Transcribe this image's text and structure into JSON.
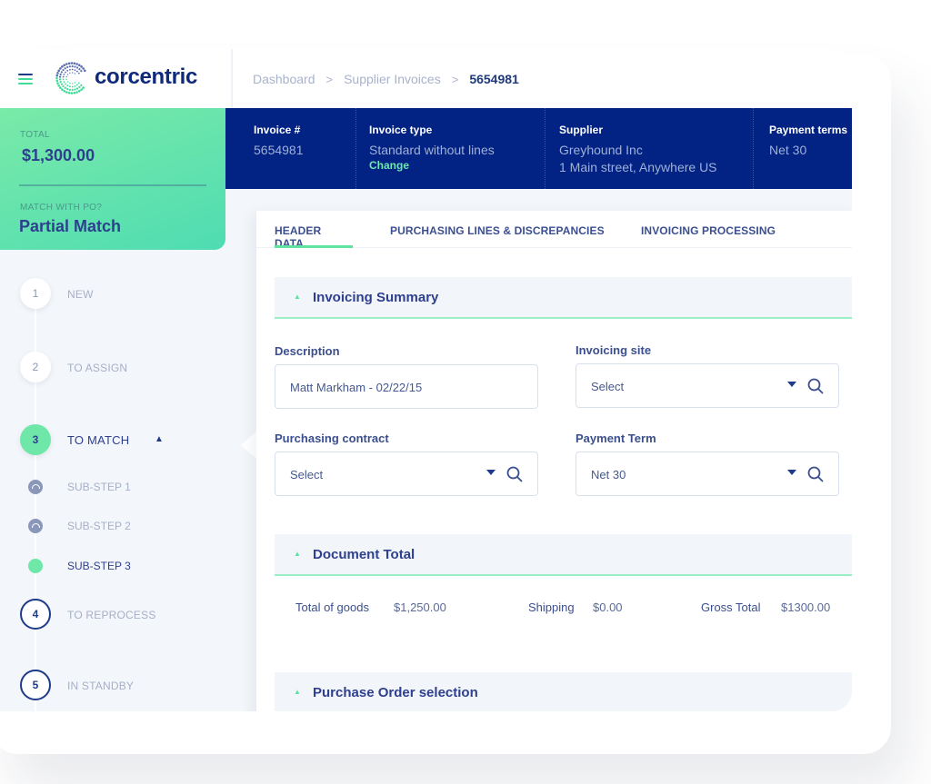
{
  "app": {
    "brand": "corcentric",
    "colors": {
      "navy": "#022383",
      "accent_green": "#5ee3a0",
      "text_dark": "#2e3f8f",
      "text_muted": "#a5b0c8",
      "background": "#f3f6fa"
    }
  },
  "topbar": {
    "menu_icon": "hamburger-menu-icon",
    "logo_icon": "corcentric-dotted-circle-logo",
    "breadcrumb": {
      "items": [
        "Dashboard",
        "Supplier Invoices"
      ],
      "separator": ">",
      "current": "5654981"
    }
  },
  "summary": {
    "total_label": "TOTAL",
    "total_value": "$1,300.00",
    "match_label": "MATCH WITH PO?",
    "match_value": "Partial Match"
  },
  "invoice_info": {
    "invoice_number": {
      "label": "Invoice #",
      "value": "5654981"
    },
    "invoice_type": {
      "label": "Invoice type",
      "value": "Standard without lines",
      "action": "Change"
    },
    "supplier": {
      "label": "Supplier",
      "name": "Greyhound Inc",
      "address": "1 Main street, Anywhere US"
    },
    "payment_terms": {
      "label": "Payment terms",
      "value": "Net 30"
    }
  },
  "steps": [
    {
      "number": "1",
      "label": "NEW",
      "state": "done"
    },
    {
      "number": "2",
      "label": "TO ASSIGN",
      "state": "done"
    },
    {
      "number": "3",
      "label": "TO MATCH",
      "state": "active",
      "expanded": true,
      "substeps": [
        {
          "label": "SUB-STEP 1",
          "state": "done"
        },
        {
          "label": "SUB-STEP 2",
          "state": "done"
        },
        {
          "label": "SUB-STEP 3",
          "state": "current"
        }
      ]
    },
    {
      "number": "4",
      "label": "TO REPROCESS",
      "state": "pending"
    },
    {
      "number": "5",
      "label": "IN STANDBY",
      "state": "pending"
    }
  ],
  "tabs": [
    {
      "label": "HEADER DATA",
      "active": true
    },
    {
      "label": "PURCHASING LINES & DISCREPANCIES",
      "active": false
    },
    {
      "label": "INVOICING PROCESSING",
      "active": false
    }
  ],
  "invoicing_summary": {
    "title": "Invoicing Summary",
    "description": {
      "label": "Description",
      "value": "Matt Markham - 02/22/15"
    },
    "invoicing_site": {
      "label": "Invoicing site",
      "value": "Select"
    },
    "purchasing_contract": {
      "label": "Purchasing contract",
      "value": "Select"
    },
    "payment_term": {
      "label": "Payment Term",
      "value": "Net 30"
    }
  },
  "document_total": {
    "title": "Document Total",
    "total_of_goods": {
      "label": "Total of goods",
      "value": "$1,250.00"
    },
    "shipping": {
      "label": "Shipping",
      "value": "$0.00"
    },
    "gross_total": {
      "label": "Gross Total",
      "value": "$1300.00"
    }
  },
  "purchase_order_selection": {
    "title": "Purchase Order selection"
  }
}
